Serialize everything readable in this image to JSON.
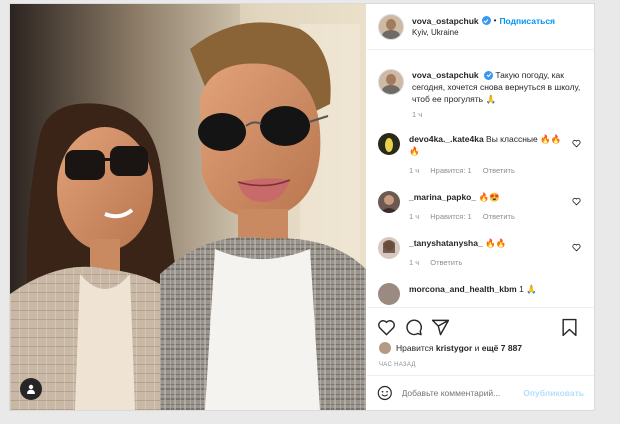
{
  "post": {
    "username": "vova_ostapchuk",
    "follow_label": "Подписаться",
    "separator": "•",
    "location": "Kyiv, Ukraine",
    "caption_user": "vova_ostapchuk",
    "caption_text": "Такую погоду, как сегодня, хочется снова вернуться в школу, чтоб ее прогулять 🙏",
    "caption_time": "1 ч"
  },
  "comments": [
    {
      "user": "devo4ka._.kate4ka",
      "text": "Вы классные 🔥🔥🔥",
      "time": "1 ч",
      "likes": "Нравится: 1",
      "reply": "Ответить"
    },
    {
      "user": "_marina_papko_",
      "text": "🔥😍",
      "time": "1 ч",
      "likes": "Нравится: 1",
      "reply": "Ответить"
    },
    {
      "user": "_tanyshatanysha_",
      "text": "🔥🔥",
      "time": "1 ч",
      "reply": "Ответить"
    },
    {
      "user": "morcona_and_health_kbm",
      "text": "1 🙏"
    }
  ],
  "likes": {
    "prefix": "Нравится",
    "user": "kristygor",
    "connector": "и",
    "others": "ещё 7 887"
  },
  "time_ago": "час назад",
  "add_comment": {
    "placeholder": "Добавьте комментарий...",
    "publish_label": "Опубликовать"
  },
  "colors": {
    "accent": "#0095f6",
    "verified": "#3897f0",
    "publish_disabled": "#b2dffc"
  }
}
